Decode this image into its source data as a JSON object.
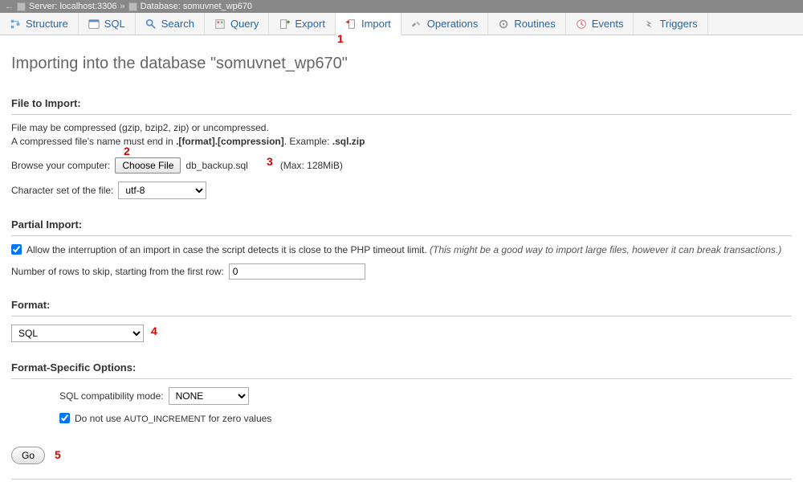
{
  "breadcrumb": {
    "server_prefix": "Server:",
    "server_value": "localhost:3306",
    "db_prefix": "Database:",
    "db_value": "somuvnet_wp670"
  },
  "tabs": [
    {
      "label": "Structure",
      "icon": "structure-icon"
    },
    {
      "label": "SQL",
      "icon": "sql-icon"
    },
    {
      "label": "Search",
      "icon": "search-icon"
    },
    {
      "label": "Query",
      "icon": "query-icon"
    },
    {
      "label": "Export",
      "icon": "export-icon"
    },
    {
      "label": "Import",
      "icon": "import-icon",
      "active": true
    },
    {
      "label": "Operations",
      "icon": "operations-icon"
    },
    {
      "label": "Routines",
      "icon": "routines-icon"
    },
    {
      "label": "Events",
      "icon": "events-icon"
    },
    {
      "label": "Triggers",
      "icon": "triggers-icon"
    }
  ],
  "heading": "Importing into the database \"somuvnet_wp670\"",
  "file_to_import": {
    "title": "File to Import:",
    "help1": "File may be compressed (gzip, bzip2, zip) or uncompressed.",
    "help2_a": "A compressed file's name must end in ",
    "help2_b": ".[format].[compression]",
    "help2_c": ". Example: ",
    "help2_d": ".sql.zip",
    "browse_label": "Browse your computer:",
    "choose_btn": "Choose File",
    "filename": "db_backup.sql",
    "max": "(Max: 128MiB)",
    "charset_label": "Character set of the file:",
    "charset_value": "utf-8"
  },
  "partial_import": {
    "title": "Partial Import:",
    "allow_label_a": "Allow the interruption of an import in case the script detects it is close to the PHP timeout limit. ",
    "allow_label_b": "(This might be a good way to import large files, however it can break transactions.)",
    "skip_label": "Number of rows to skip, starting from the first row:",
    "skip_value": "0"
  },
  "format": {
    "title": "Format:",
    "value": "SQL"
  },
  "format_options": {
    "title": "Format-Specific Options:",
    "compat_label": "SQL compatibility mode:",
    "compat_value": "NONE",
    "autoinc_a": "Do not use ",
    "autoinc_b": "AUTO_INCREMENT",
    "autoinc_c": " for zero values"
  },
  "go_btn": "Go",
  "annotations": {
    "a1": "1",
    "a2": "2",
    "a3": "3",
    "a4": "4",
    "a5": "5"
  }
}
